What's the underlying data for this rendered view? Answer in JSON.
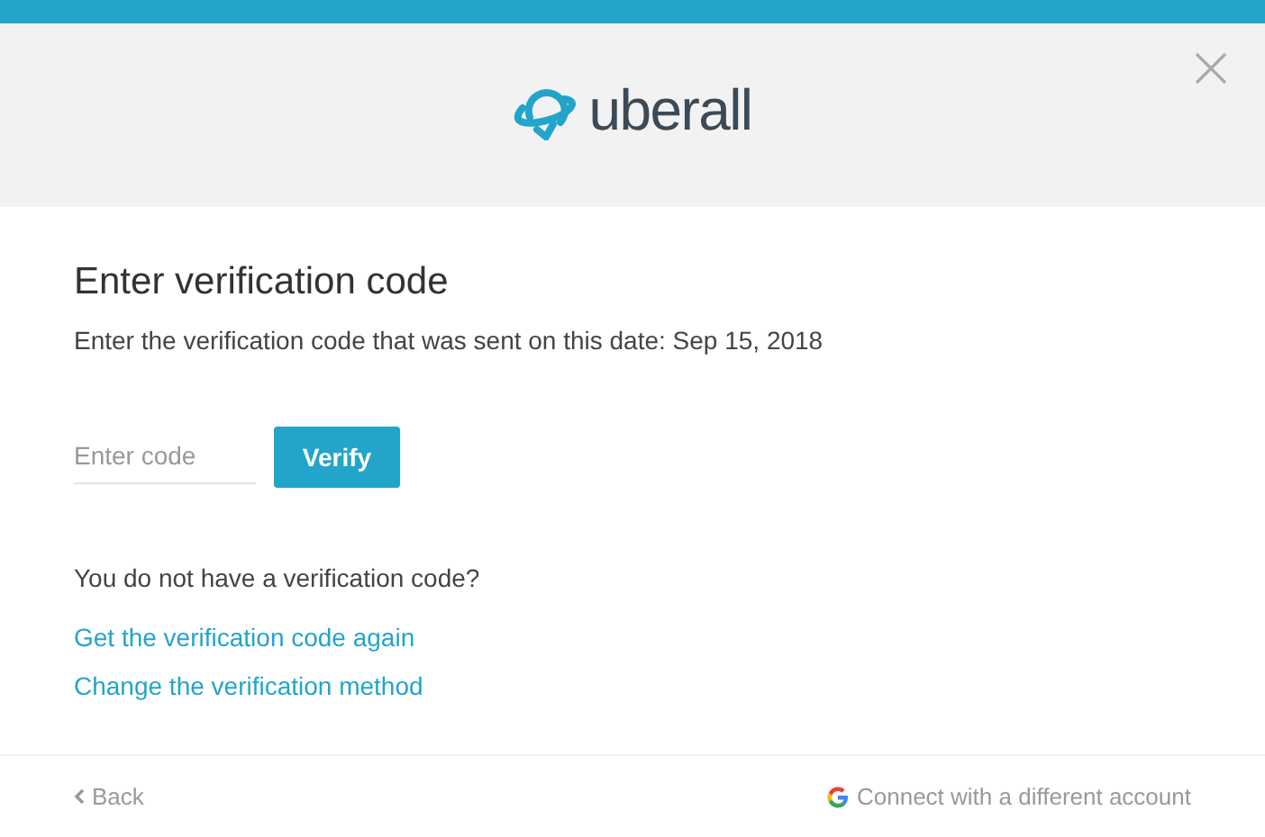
{
  "header": {
    "logo": "uberall"
  },
  "title": "Enter verification code",
  "description": "Enter the verification code that was sent on this date: Sep 15, 2018",
  "code_field": {
    "placeholder": "Enter code"
  },
  "verify_button": "Verify",
  "help_text": "You do not have a verification code?",
  "links": [
    "Get the verification code again",
    "Change the verification method"
  ],
  "footer": {
    "back": "Back",
    "connect": "Connect with a different account"
  }
}
